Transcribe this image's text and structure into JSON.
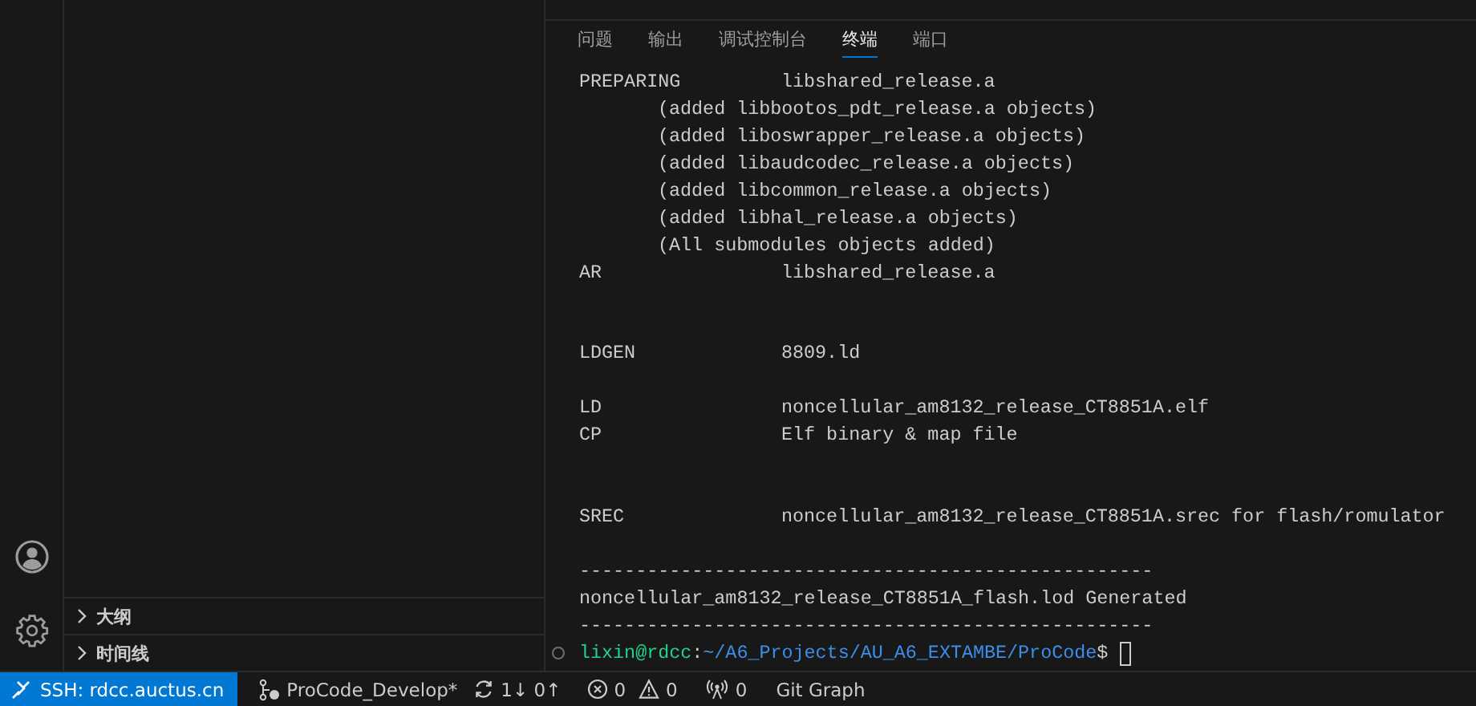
{
  "sidebar": {
    "sections": [
      {
        "label": "大纲",
        "expanded": false
      },
      {
        "label": "时间线",
        "expanded": false
      }
    ]
  },
  "panel": {
    "tabs": [
      {
        "label": "问题",
        "selected": false
      },
      {
        "label": "输出",
        "selected": false
      },
      {
        "label": "调试控制台",
        "selected": false
      },
      {
        "label": "终端",
        "selected": true
      },
      {
        "label": "端口",
        "selected": false
      }
    ],
    "terminal": {
      "lines": [
        {
          "kind": "entry",
          "label": "PREPARING",
          "value": "libshared_release.a"
        },
        {
          "kind": "note",
          "text": "(added libbootos_pdt_release.a objects)"
        },
        {
          "kind": "note",
          "text": "(added liboswrapper_release.a objects)"
        },
        {
          "kind": "note",
          "text": "(added libaudcodec_release.a objects)"
        },
        {
          "kind": "note",
          "text": "(added libcommon_release.a objects)"
        },
        {
          "kind": "note",
          "text": "(added libhal_release.a objects)"
        },
        {
          "kind": "note",
          "text": "(All submodules objects added)"
        },
        {
          "kind": "entry",
          "label": "AR",
          "value": "libshared_release.a"
        },
        {
          "kind": "blank"
        },
        {
          "kind": "blank"
        },
        {
          "kind": "entry",
          "label": "LDGEN",
          "value": "8809.ld"
        },
        {
          "kind": "blank"
        },
        {
          "kind": "entry",
          "label": "LD",
          "value": "noncellular_am8132_release_CT8851A.elf"
        },
        {
          "kind": "entry",
          "label": "CP",
          "value": "Elf binary & map file"
        },
        {
          "kind": "blank"
        },
        {
          "kind": "blank"
        },
        {
          "kind": "entry",
          "label": "SREC",
          "value": "noncellular_am8132_release_CT8851A.srec for flash/romulator"
        },
        {
          "kind": "blank"
        },
        {
          "kind": "text",
          "text": "---------------------------------------------------"
        },
        {
          "kind": "text",
          "text": "noncellular_am8132_release_CT8851A_flash.lod Generated"
        },
        {
          "kind": "text",
          "text": "---------------------------------------------------"
        }
      ],
      "prompt": {
        "user": "lixin@rdcc",
        "sep": ":",
        "path": "~/A6_Projects/AU_A6_EXTAMBE/ProCode",
        "symbol": "$"
      }
    }
  },
  "status_bar": {
    "remote": "SSH: rdcc.auctus.cn",
    "branch": "ProCode_Develop*",
    "sync": "1↓ 0↑",
    "errors": "0",
    "warnings": "0",
    "ports": "0",
    "git_graph": "Git Graph"
  }
}
